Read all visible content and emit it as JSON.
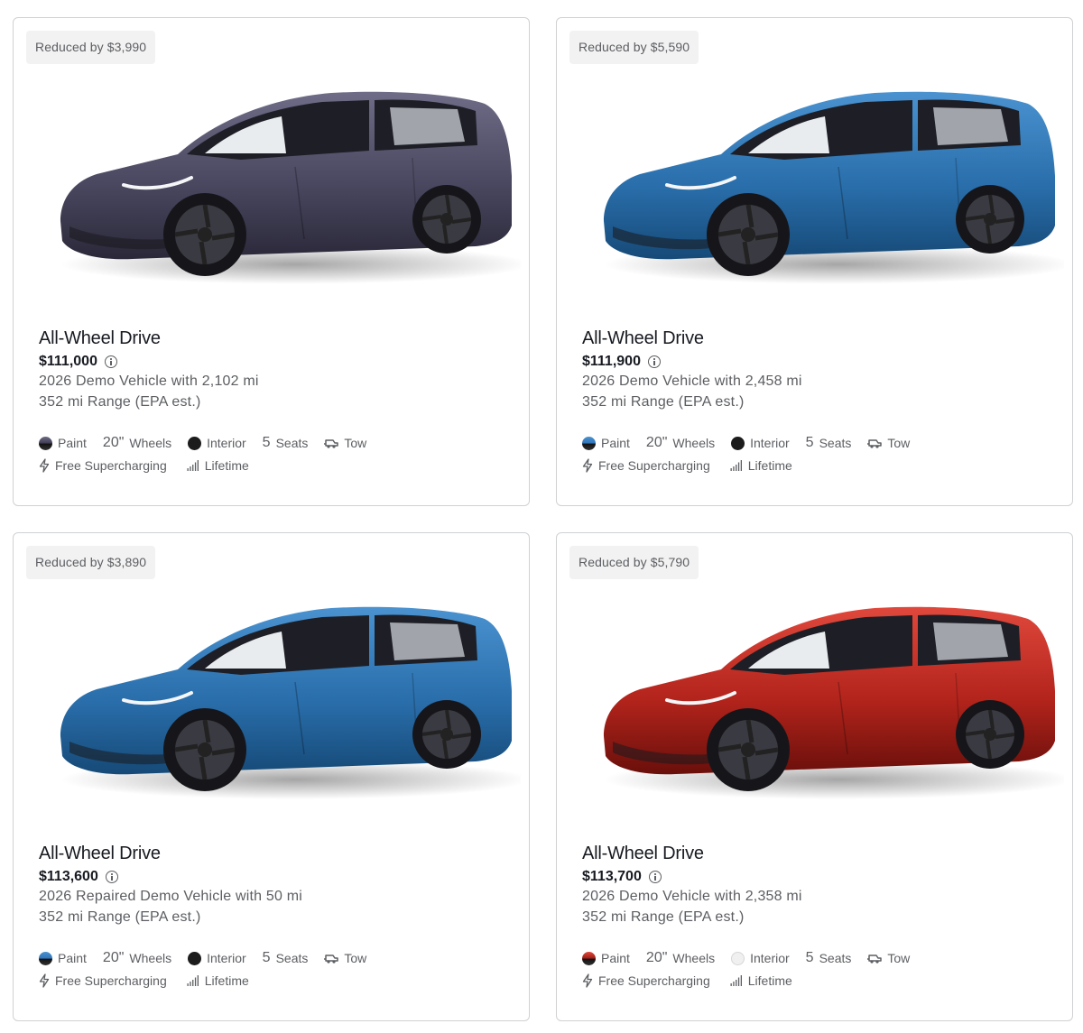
{
  "labels": {
    "paint": "Paint",
    "wheels": "Wheels",
    "interior": "Interior",
    "seats": "Seats",
    "tow": "Tow",
    "supercharging": "Free Supercharging",
    "lifetime": "Lifetime"
  },
  "icons": {
    "info": "info-circle-icon",
    "tow": "tow-hitch-icon",
    "bolt": "lightning-bolt-icon",
    "signal": "signal-bars-icon"
  },
  "cards": [
    {
      "badge": "Reduced by $3,990",
      "title": "All-Wheel Drive",
      "price": "$111,000",
      "description": "2026 Demo Vehicle with 2,102 mi",
      "range": "352 mi Range (EPA est.)",
      "wheels_size": "20\"",
      "seats_count": "5",
      "paint_color": "#3e3c52",
      "interior_color": "#1c1c1c",
      "car_body": "#4a4860",
      "car_dark": "#2a2838",
      "car_light": "#6e6c86"
    },
    {
      "badge": "Reduced by $5,590",
      "title": "All-Wheel Drive",
      "price": "$111,900",
      "description": "2026 Demo Vehicle with 2,458 mi",
      "range": "352 mi Range (EPA est.)",
      "wheels_size": "20\"",
      "seats_count": "5",
      "paint_color": "#2f74b8",
      "interior_color": "#1c1c1c",
      "car_body": "#2a6fac",
      "car_dark": "#164a78",
      "car_light": "#4a92d0"
    },
    {
      "badge": "Reduced by $3,890",
      "title": "All-Wheel Drive",
      "price": "$113,600",
      "description": "2026 Repaired Demo Vehicle with 50 mi",
      "range": "352 mi Range (EPA est.)",
      "wheels_size": "20\"",
      "seats_count": "5",
      "paint_color": "#2f74b8",
      "interior_color": "#1c1c1c",
      "car_body": "#2a6fac",
      "car_dark": "#164a78",
      "car_light": "#4a92d0"
    },
    {
      "badge": "Reduced by $5,790",
      "title": "All-Wheel Drive",
      "price": "$113,700",
      "description": "2026 Demo Vehicle with 2,358 mi",
      "range": "352 mi Range (EPA est.)",
      "wheels_size": "20\"",
      "seats_count": "5",
      "paint_color": "#9e1c16",
      "interior_color": "#f0f0f0",
      "car_body": "#b3241c",
      "car_dark": "#6a0f0b",
      "car_light": "#e0483c"
    }
  ]
}
